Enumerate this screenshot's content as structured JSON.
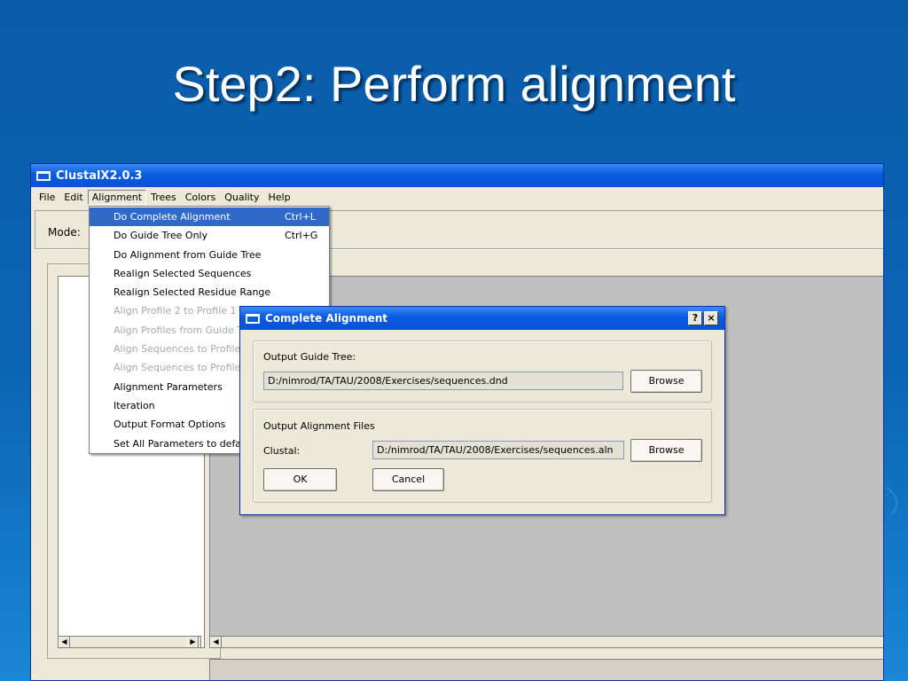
{
  "slide": {
    "title": "Step2: Perform alignment"
  },
  "app": {
    "title": "ClustalX2.0.3",
    "menu": [
      {
        "label": "File"
      },
      {
        "label": "Edit"
      },
      {
        "label": "Alignment"
      },
      {
        "label": "Trees"
      },
      {
        "label": "Colors"
      },
      {
        "label": "Quality"
      },
      {
        "label": "Help"
      }
    ],
    "mode_label": "Mode:"
  },
  "alignment_menu": {
    "items": [
      {
        "label": "Do Complete Alignment",
        "shortcut": "Ctrl+L",
        "state": "selected"
      },
      {
        "label": "Do Guide Tree Only",
        "shortcut": "Ctrl+G",
        "state": "enabled"
      },
      {
        "label": "Do Alignment from Guide Tree",
        "shortcut": "",
        "state": "enabled"
      },
      {
        "label": "Realign Selected Sequences",
        "shortcut": "",
        "state": "enabled"
      },
      {
        "label": "Realign Selected Residue Range",
        "shortcut": "",
        "state": "enabled"
      },
      {
        "label": "Align Profile 2 to Profile 1",
        "shortcut": "",
        "state": "disabled"
      },
      {
        "label": "Align Profiles from Guide Tree",
        "shortcut": "",
        "state": "disabled"
      },
      {
        "label": "Align Sequences to Profile 1",
        "shortcut": "",
        "state": "disabled"
      },
      {
        "label": "Align Sequences to Profile 1 from Tree",
        "shortcut": "",
        "state": "disabled"
      },
      {
        "label": "Alignment Parameters",
        "shortcut": "",
        "state": "enabled"
      },
      {
        "label": "Iteration",
        "shortcut": "",
        "state": "enabled"
      },
      {
        "label": "Output Format Options",
        "shortcut": "",
        "state": "enabled"
      },
      {
        "label": "Set All Parameters to default",
        "shortcut": "",
        "state": "enabled"
      }
    ]
  },
  "dialog": {
    "title": "Complete Alignment",
    "help_label": "?",
    "close_label": "×",
    "guide_tree": {
      "group_label": "Output Guide Tree:",
      "path": "D:/nimrod/TA/TAU/2008/Exercises/sequences.dnd",
      "browse_label": "Browse"
    },
    "alignment_files": {
      "group_label": "Output Alignment Files",
      "clustal_label": "Clustal:",
      "path": "D:/nimrod/TA/TAU/2008/Exercises/sequences.aln",
      "browse_label": "Browse"
    },
    "ok_label": "OK",
    "cancel_label": "Cancel"
  },
  "icons": {
    "window": "window-icon",
    "scroll_left": "arrow-left-icon",
    "scroll_right": "arrow-right-icon"
  }
}
